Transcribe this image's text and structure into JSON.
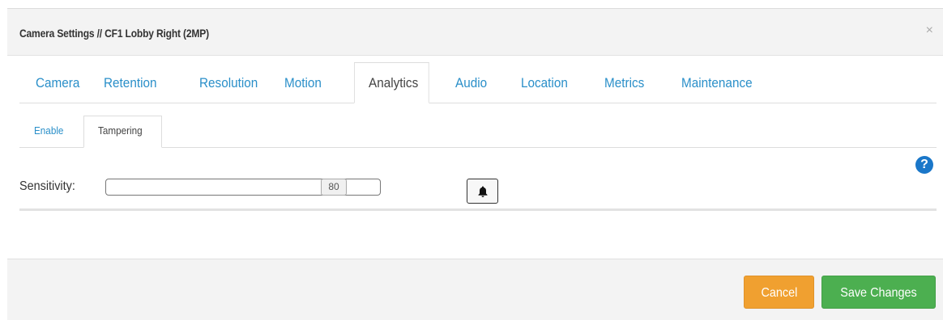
{
  "header": {
    "title": "Camera Settings // CF1 Lobby Right (2MP)",
    "close": "×"
  },
  "tabs": [
    "Camera",
    "Retention",
    "Resolution",
    "Motion",
    "Analytics",
    "Audio",
    "Location",
    "Metrics",
    "Maintenance"
  ],
  "active_tab": "Analytics",
  "subtabs": [
    "Enable",
    "Tampering"
  ],
  "active_subtab": "Tampering",
  "sensitivity": {
    "label": "Sensitivity:",
    "value": "80",
    "fraction": 0.8
  },
  "help_icon": "?",
  "footer": {
    "cancel_label": "Cancel",
    "save_label": "Save Changes"
  },
  "colors": {
    "link": "#2a8fc9",
    "cancel": "#f0a030",
    "save": "#4caf50",
    "help": "#1a77c9"
  }
}
